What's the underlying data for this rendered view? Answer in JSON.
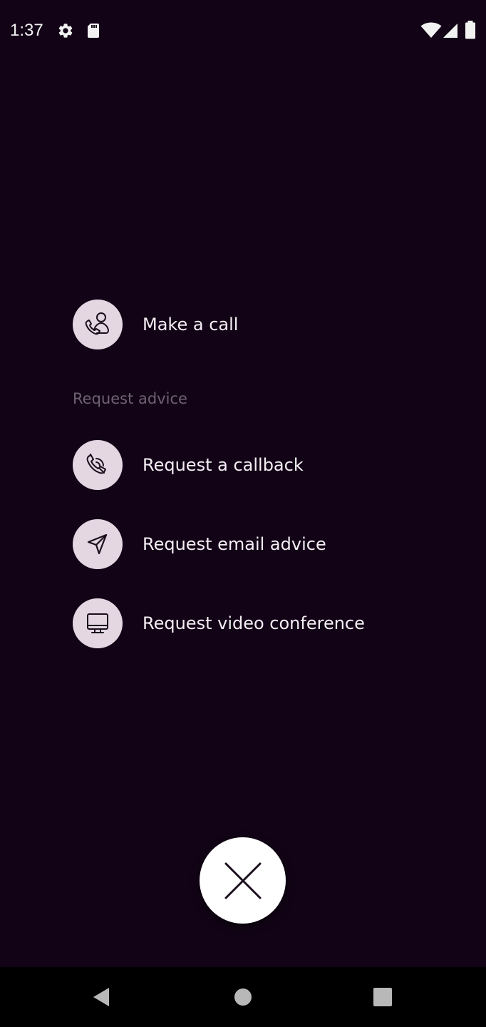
{
  "status_bar": {
    "time": "1:37",
    "icons": [
      "gear-icon",
      "sd-card-icon",
      "wifi-icon",
      "cell-signal-icon",
      "battery-icon"
    ]
  },
  "actions": {
    "make_call": {
      "label": "Make a call",
      "icon": "phone-person-icon"
    },
    "section_label": "Request advice",
    "items": [
      {
        "label": "Request a callback",
        "icon": "phone-callback-icon"
      },
      {
        "label": "Request email advice",
        "icon": "send-arrow-icon"
      },
      {
        "label": "Request video conference",
        "icon": "monitor-icon"
      }
    ]
  },
  "fab": {
    "icon": "close-icon"
  },
  "nav_bar": {
    "buttons": [
      "back-icon",
      "home-icon",
      "recents-icon"
    ]
  },
  "colors": {
    "background": "#120416",
    "icon_circle": "#e4d7e2",
    "section_label": "#6f6372",
    "fab": "#ffffff",
    "nav_bar": "#000000"
  }
}
